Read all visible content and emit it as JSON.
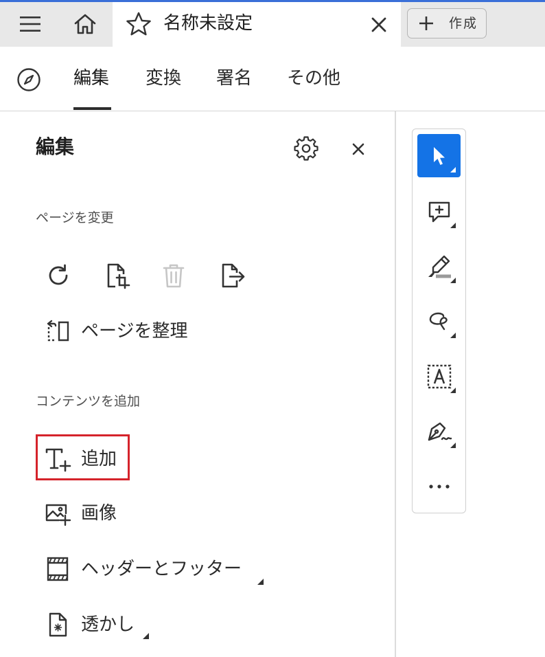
{
  "tabbar": {
    "document_title": "名称未設定",
    "create_label": "作成"
  },
  "toolbar": {
    "tabs": [
      {
        "label": "編集",
        "active": true
      },
      {
        "label": "変換",
        "active": false
      },
      {
        "label": "署名",
        "active": false
      },
      {
        "label": "その他",
        "active": false
      }
    ]
  },
  "panel": {
    "title": "編集",
    "sections": {
      "pages": {
        "heading": "ページを変更",
        "icons": [
          "rotate-icon",
          "crop-icon",
          "delete-icon",
          "extract-icon"
        ],
        "organize_label": "ページを整理"
      },
      "content": {
        "heading": "コンテンツを追加",
        "items": [
          {
            "label": "追加",
            "icon": "add-text-icon",
            "highlighted": true
          },
          {
            "label": "画像",
            "icon": "add-image-icon"
          },
          {
            "label": "ヘッダーとフッター",
            "icon": "header-footer-icon",
            "has_submenu": true
          },
          {
            "label": "透かし",
            "icon": "watermark-icon",
            "has_submenu": true
          }
        ]
      }
    }
  },
  "quick_tools": [
    "select-icon",
    "comment-icon",
    "highlight-icon",
    "draw-icon",
    "text-select-icon",
    "sign-icon",
    "more-icon"
  ],
  "colors": {
    "accent": "#1473e6",
    "highlight_border": "#d5232b",
    "tabbar_background": "#e8e8e8",
    "top_accent_line": "#3a6fd8"
  }
}
